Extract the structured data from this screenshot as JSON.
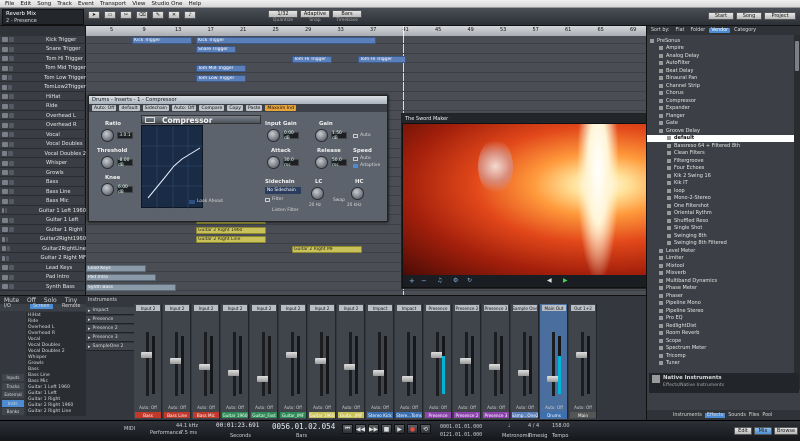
{
  "menu": [
    "File",
    "Edit",
    "Song",
    "Track",
    "Event",
    "Transport",
    "View",
    "Studio One",
    "Help"
  ],
  "toolbar": {
    "reverb_label": "Reverb Mix",
    "preset_label": "2 - Presence",
    "quantize_value": "1/32",
    "quantize_label": "Quantize",
    "snap_value": "Adaptive",
    "snap_label": "Snap",
    "timebase_value": "Bars",
    "timebase_label": "Timebase",
    "start_button": "Start",
    "song_button": "Song",
    "project_button": "Project"
  },
  "tracks": [
    "Kick Trigger",
    "Snare Trigger",
    "Tom Hi Trigger",
    "Tom Mid Trigger",
    "Tom Low Trigger",
    "TomLow2Trigger",
    "HiHat",
    "Ride",
    "Overhead L",
    "Overhead R",
    "Vocal",
    "Vocal Doubles",
    "Vocal Doubles 2",
    "Whisper",
    "Growls",
    "Bass",
    "Bass Line",
    "Bass Mic",
    "Guitar 1 Left 1960",
    "Guitar 1 Left",
    "Guitar 1 Right",
    "Guitar2Right1960",
    "Guitar2RightLine",
    "Guitar 2 Right MF",
    "Lead Keys",
    "Pad Intro",
    "Synth Bass"
  ],
  "arrange": {
    "ruler": [
      "5",
      "9",
      "13",
      "17",
      "21",
      "25",
      "29",
      "33",
      "37",
      "41",
      "45",
      "49",
      "53",
      "57",
      "61",
      "65",
      "69"
    ],
    "clips": [
      "Kick Trigger",
      "Kick Trigger",
      "Snare Trigger",
      "Tom Hi Trigger",
      "Tom Hi Trigger",
      "Tom Mid Trigger",
      "Tom Low Trigger",
      "Guitar 1 Left 1960",
      "Guitar 1 Left",
      "Guitar 1 Right",
      "Guitar 2 Right 1960",
      "Guitar 2 Right Line",
      "Guitar 2 Right MF",
      "Lead Keys",
      "Pad Intro",
      "Synth Bass"
    ]
  },
  "compressor": {
    "title": "Drums - Inserts - 1 - Compressor",
    "chips": [
      "Auto: Off",
      "default",
      "Sidechain",
      "Auto: Off",
      "Compare",
      "Copy",
      "Paste",
      "Maxxim Ind"
    ],
    "name": "Compressor",
    "ratio_label": "Ratio",
    "ratio_value": "3.0:1",
    "threshold_label": "Threshold",
    "threshold_value": "-8.00 dB",
    "knee_label": "Knee",
    "knee_value": "6.00 dB",
    "input_gain_label": "Input Gain",
    "input_gain_value": "0.00 dB",
    "gain_label": "Gain",
    "gain_value": "1.50 dB",
    "attack_label": "Attack",
    "attack_value": "30.0 ms",
    "release_label": "Release",
    "release_value": "50.0 ms",
    "auto_label": "Auto",
    "speed_label": "Speed",
    "adaptive_label": "Adaptive",
    "look_ahead_label": "Look Ahead",
    "stereo_link_label": "Stereo Link",
    "sidechain_label": "Sidechain",
    "no_sidechain": "No Sidechain",
    "filter_label": "Filter",
    "listen_filter_label": "Listen Filter",
    "lc_label": "LC",
    "hc_label": "HC",
    "lc_value": "20 Hz",
    "hc_value": "20 kHz",
    "swap_label": "Swap"
  },
  "video": {
    "title": "The Sword Maker"
  },
  "browser": {
    "sort_label": "Sort by:",
    "tabs": [
      "Flat",
      "Folder",
      "Vendor",
      "Category"
    ],
    "vendor": "PreSonus",
    "items": [
      "Ampire",
      "Analog Delay",
      "AutoFilter",
      "Beat Delay",
      "Binaural Pan",
      "Channel Strip",
      "Chorus",
      "Compressor",
      "Expander",
      "Flanger",
      "Gate",
      "Groove Delay",
      "default",
      "Bassreso 64 + Filtered 8th",
      "Clean Filters",
      "Filtergroove",
      "Four Echoes",
      "Kik 2 Swing 16",
      "Kik IT",
      "loop",
      "Mono-2-Stereo",
      "One Filtershot",
      "Oriental Rythm",
      "Shuffled Reso",
      "Single Shot",
      "Swinging 8th",
      "Swinging 8th Filtered",
      "Level Meter",
      "Limiter",
      "Mixtool",
      "Mixverb",
      "Multiband Dynamics",
      "Phase Meter",
      "Phaser",
      "Pipeline Mono",
      "Pipeline Stereo",
      "Pro EQ",
      "RedlightDist",
      "Room Reverb",
      "Scope",
      "Spectrum Meter",
      "Tricomp",
      "Tuner"
    ],
    "info_title": "Native Instruments",
    "info_sub": "Effects/Native Instruments",
    "bottom_tabs": [
      "Instruments",
      "Effects",
      "Sounds",
      "Files",
      "Pool"
    ]
  },
  "mixer": {
    "side_tabs": [
      "Mute",
      "Off",
      "Solo",
      "Tiny"
    ],
    "screen_tab": "Screen",
    "remote_tab": "Remote",
    "io_label": "I/O",
    "left_items": [
      "HiHat",
      "Ride",
      "Overhead L",
      "Overhead R",
      "Vocal",
      "Vocal Doubles",
      "Vocal Doubles 2",
      "Whisper",
      "Growls",
      "Bass",
      "Bass Line",
      "Bass Mic",
      "Guitar 1 Left 1960",
      "Guitar 1 Left",
      "Guitar 1 Right",
      "Guitar 2 Right 1960",
      "Guitar 2 Right Line"
    ],
    "side_buttons": [
      "Inputs",
      "Tracks",
      "External",
      "Instr.",
      "Banks"
    ],
    "instruments_label": "Instruments",
    "groups": [
      "Impact",
      "Presence",
      "Presence 2",
      "Presence 3",
      "SampleOne 2"
    ],
    "strip_inputs": [
      "Input 2",
      "Input 2",
      "Input 2",
      "Input 2",
      "Input 2",
      "Input 2",
      "Input 2",
      "Input 2",
      "Impact",
      "Impact",
      "Presence",
      "Presence 2",
      "Presence 3",
      "Sample One",
      "Main Out",
      "Out 1+2"
    ],
    "strip_names": [
      "Bass",
      "Bass Line",
      "Bass Mic",
      "Guitar 1960",
      "Guitar_Fast",
      "Guitar_IMF",
      "Guitar 1960",
      "Guita...IMF",
      "Stereo Kick",
      "Stere...Toms",
      "Presence",
      "Presence 2",
      "Presence 3",
      "Samp...One2",
      "Drums",
      "Main"
    ],
    "strip_colors": [
      "#c0392b",
      "#c0392b",
      "#c0392b",
      "#2e8b57",
      "#2e8b57",
      "#2e8b57",
      "#c9c25a",
      "#c9c25a",
      "#3a6fb0",
      "#3a6fb0",
      "#8e44ad",
      "#8e44ad",
      "#8e44ad",
      "#5b7fb8",
      "#3a6fb0",
      "#555"
    ],
    "auto_label": "Auto: Off"
  },
  "transport": {
    "sample_rate": "44.1 kHz",
    "latency": "7.5 ms",
    "midi_label": "MIDI",
    "performance_label": "Performance",
    "time_seconds": "00:01:23.691",
    "seconds_label": "Seconds",
    "time_bars": "0056.01.02.054",
    "bars_label": "Bars",
    "loop_start": "0001.01.01.000",
    "loop_end": "0121.01.01.000",
    "metronome_label": "Metronome",
    "timesig_value": "4 / 4",
    "timesig_label": "Timesig",
    "tempo_value": "158.00",
    "tempo_label": "Tempo",
    "edit_button": "Edit",
    "mix_button": "Mix",
    "browse_button": "Browse"
  }
}
